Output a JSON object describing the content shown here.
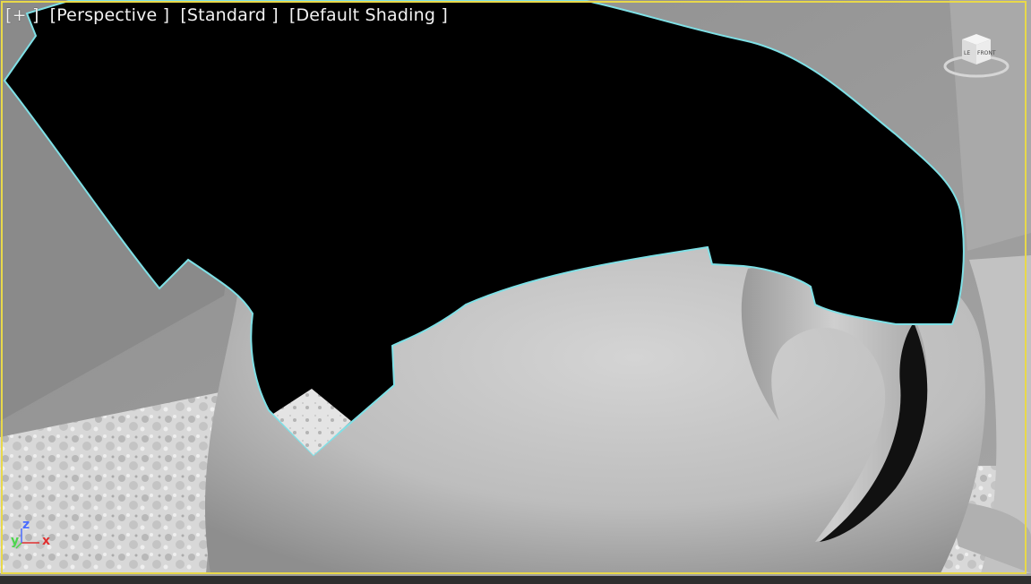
{
  "viewport": {
    "labels": {
      "maximize": "[+ ]",
      "view": "[Perspective ]",
      "renderer": "[Standard ]",
      "shading": "[Default Shading ]"
    },
    "viewcube": {
      "left_face": "LE",
      "front_face": "FRONT"
    },
    "axis": {
      "x": "x",
      "y": "y",
      "z": "z"
    }
  },
  "colors": {
    "viewport_border": "#e8d84a",
    "selection_outline": "#7fe0e6",
    "axis_x": "#e03030",
    "axis_y": "#4cd64c",
    "axis_z": "#4a6cff"
  }
}
